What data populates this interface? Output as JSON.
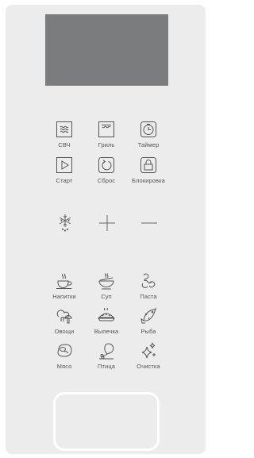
{
  "control_panel": {
    "mode_buttons": [
      {
        "icon": "microwave-waves-icon",
        "label": "СВЧ"
      },
      {
        "icon": "grill-icon",
        "label": "Гриль"
      },
      {
        "icon": "timer-icon",
        "label": "Таймер"
      }
    ],
    "action_buttons": [
      {
        "icon": "play-icon",
        "label": "Старт"
      },
      {
        "icon": "reset-icon",
        "label": "Сброс"
      },
      {
        "icon": "lock-icon",
        "label": "Блокировка"
      }
    ],
    "adjust_controls": [
      {
        "icon": "defrost-snowflake-icon"
      },
      {
        "icon": "plus-icon"
      },
      {
        "icon": "minus-icon"
      }
    ],
    "programs": [
      {
        "icon": "drink-cup-icon",
        "label": "Напитки"
      },
      {
        "icon": "soup-bowl-icon",
        "label": "Суп"
      },
      {
        "icon": "pasta-icon",
        "label": "Паста"
      },
      {
        "icon": "vegetables-icon",
        "label": "Овощи"
      },
      {
        "icon": "pie-icon",
        "label": "Выпечка"
      },
      {
        "icon": "fish-icon",
        "label": "Рыба"
      },
      {
        "icon": "steak-icon",
        "label": "Мясо"
      },
      {
        "icon": "chicken-leg-icon",
        "label": "Птица"
      },
      {
        "icon": "sparkles-icon",
        "label": "Очистка"
      }
    ]
  },
  "colors": {
    "panel_background": "#ececec",
    "display_background": "#7b7c7e",
    "icon_stroke": "#555555",
    "door_handle_outline": "#ffffff"
  }
}
